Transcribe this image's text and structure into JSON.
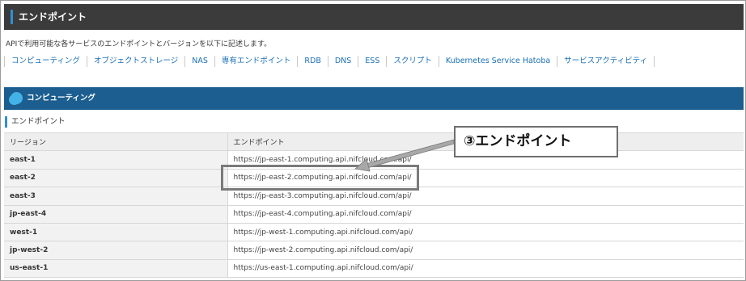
{
  "page": {
    "title": "エンドポイント",
    "intro": "APIで利用可能な各サービスのエンドポイントとバージョンを以下に記述します。"
  },
  "nav": {
    "items": [
      {
        "label": "コンピューティング"
      },
      {
        "label": "オブジェクトストレージ"
      },
      {
        "label": "NAS"
      },
      {
        "label": "専有エンドポイント"
      },
      {
        "label": "RDB"
      },
      {
        "label": "DNS"
      },
      {
        "label": "ESS"
      },
      {
        "label": "スクリプト"
      },
      {
        "label": "Kubernetes Service Hatoba"
      },
      {
        "label": "サービスアクティビティ"
      }
    ]
  },
  "section": {
    "title": "コンピューティング",
    "subheading": "エンドポイント"
  },
  "table": {
    "headers": [
      "リージョン",
      "エンドポイント"
    ],
    "rows": [
      {
        "region": "east-1",
        "endpoint": "https://jp-east-1.computing.api.nifcloud.com/api/"
      },
      {
        "region": "east-2",
        "endpoint": "https://jp-east-2.computing.api.nifcloud.com/api/"
      },
      {
        "region": "east-3",
        "endpoint": "https://jp-east-3.computing.api.nifcloud.com/api/"
      },
      {
        "region": "jp-east-4",
        "endpoint": "https://jp-east-4.computing.api.nifcloud.com/api/"
      },
      {
        "region": "west-1",
        "endpoint": "https://jp-west-1.computing.api.nifcloud.com/api/"
      },
      {
        "region": "jp-west-2",
        "endpoint": "https://jp-west-2.computing.api.nifcloud.com/api/"
      },
      {
        "region": "us-east-1",
        "endpoint": "https://us-east-1.computing.api.nifcloud.com/api/"
      }
    ]
  },
  "annotation": {
    "label": "③エンドポイント"
  },
  "colors": {
    "header_bg": "#3b3b3b",
    "accent": "#2f8fd3",
    "section_bg": "#1b5e8f",
    "link": "#1a6fb5"
  }
}
